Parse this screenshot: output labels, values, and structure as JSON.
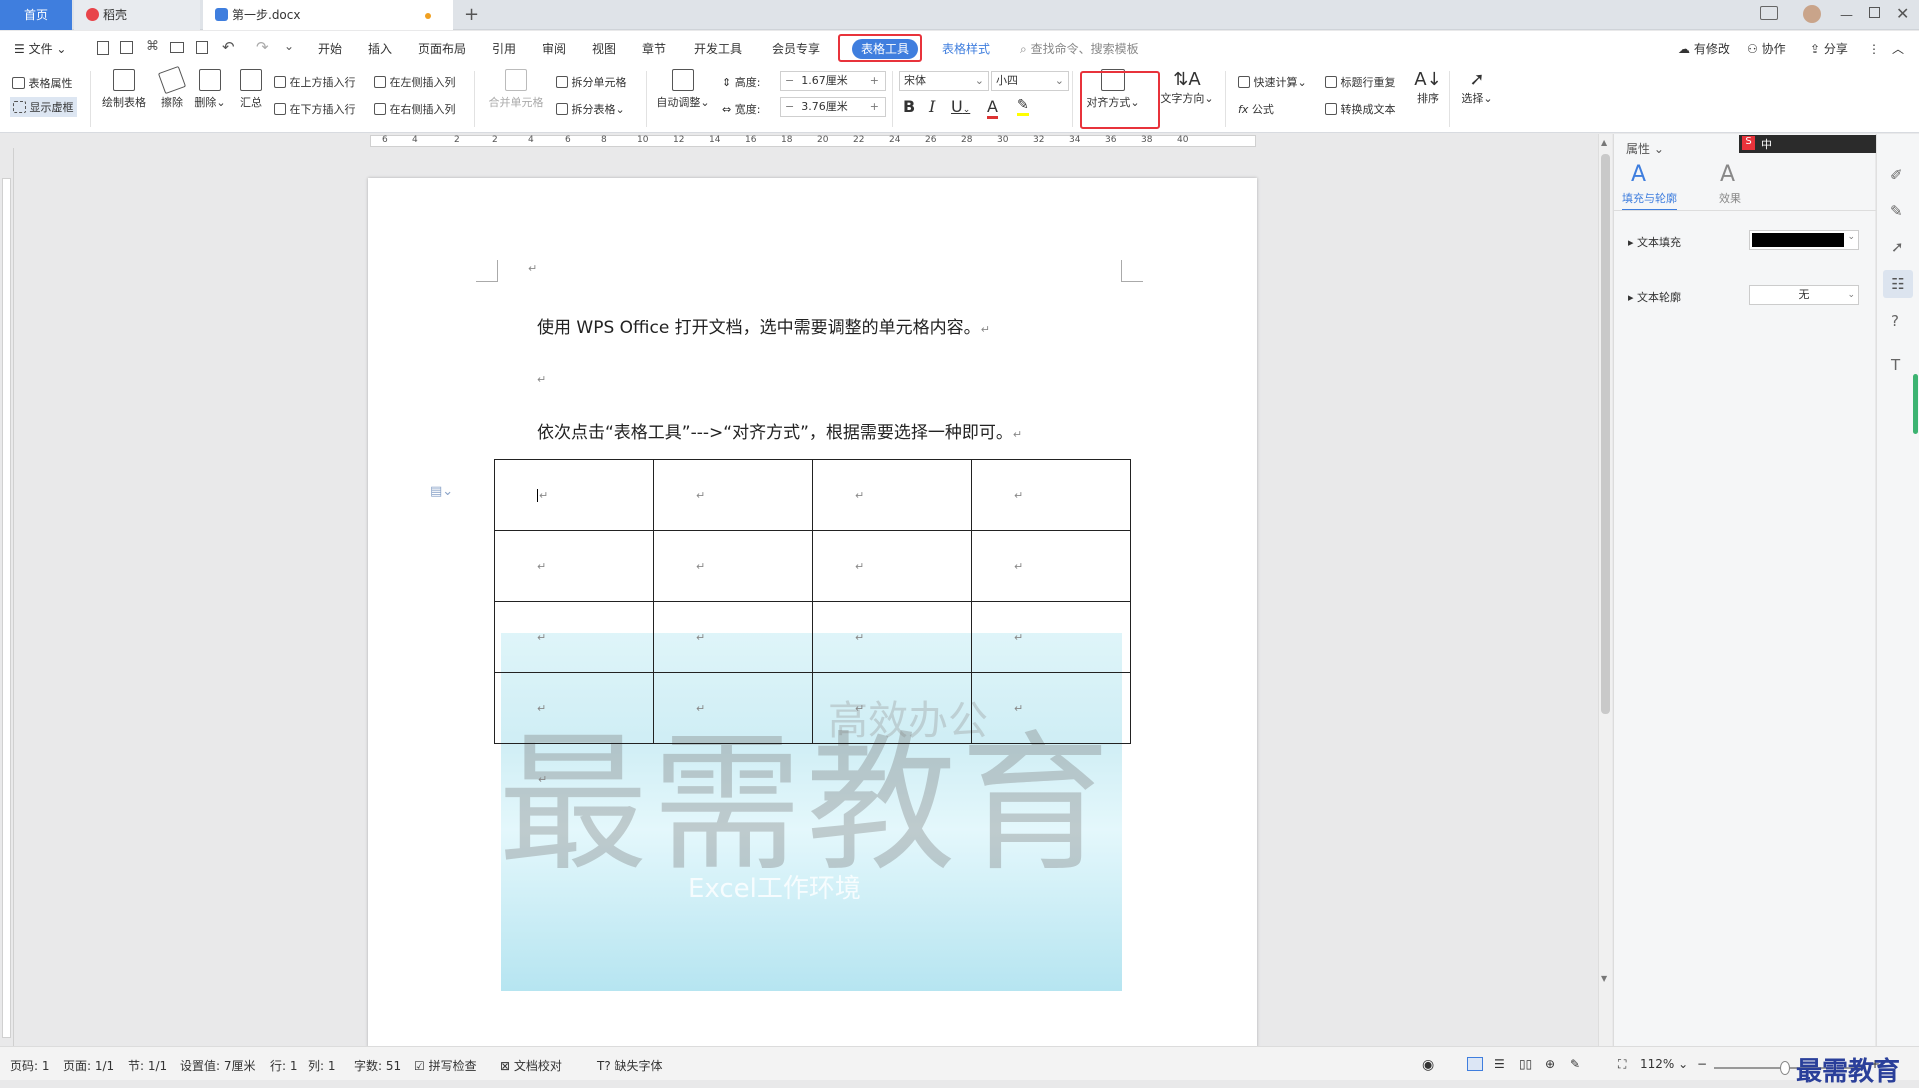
{
  "tabs": [
    {
      "label": "首页"
    },
    {
      "label": "稻壳"
    },
    {
      "label": "第一步.docx"
    }
  ],
  "menu": {
    "file": "文件",
    "items": [
      "开始",
      "插入",
      "页面布局",
      "引用",
      "审阅",
      "视图",
      "章节",
      "开发工具",
      "会员专享",
      "表格工具",
      "表格样式"
    ],
    "search": "查找命令、搜索模板",
    "right": [
      "有修改",
      "协作",
      "分享"
    ]
  },
  "ribbon": {
    "table_props": "表格属性",
    "show_grid": "显示虚框",
    "draw_table": "绘制表格",
    "erase": "擦除",
    "delete": "删除",
    "summary": "汇总",
    "insert_above": "在上方插入行",
    "insert_below": "在下方插入行",
    "insert_left": "在左侧插入列",
    "insert_right": "在右侧插入列",
    "merge_cells": "合并单元格",
    "split_cells": "拆分单元格",
    "split_table": "拆分表格",
    "auto_adjust": "自动调整",
    "height_label": "高度:",
    "height_value": "1.67厘米",
    "width_label": "宽度:",
    "width_value": "3.76厘米",
    "font_name": "宋体",
    "font_size": "小四",
    "align": "对齐方式",
    "text_direction": "文字方向",
    "quick_calc": "快速计算",
    "formula": "公式",
    "repeat_header": "标题行重复",
    "convert_text": "转换成文本",
    "sort": "排序",
    "select": "选择"
  },
  "ruler_numbers": [
    "6",
    "4",
    "2",
    "2",
    "4",
    "6",
    "8",
    "10",
    "12",
    "14",
    "16",
    "18",
    "20",
    "22",
    "24",
    "26",
    "28",
    "30",
    "32",
    "34",
    "36",
    "38",
    "40"
  ],
  "doc": {
    "line1": "使用 WPS Office 打开文档，选中需要调整的单元格内容。",
    "line2": "依次点击“表格工具”--->“对齐方式”，根据需要选择一种即可。",
    "watermark_main": "最需教育",
    "watermark_top": "高效办公",
    "watermark_sub": "Excel工作环境"
  },
  "panel": {
    "title": "属性",
    "tab1": "填充与轮廓",
    "tab2": "效果",
    "fill_label": "文本填充",
    "outline_label": "文本轮廓",
    "outline_value": "无",
    "ime_label": "中"
  },
  "status": {
    "page": "页码: 1",
    "pages": "页面: 1/1",
    "section": "节: 1/1",
    "setting": "设置值: 7厘米",
    "row": "行: 1",
    "col": "列: 1",
    "words": "字数: 51",
    "spell": "拼写检查",
    "proof": "文档校对",
    "missing_font": "缺失字体",
    "zoom": "112%"
  },
  "brand": "最需教育",
  "colors": {
    "accent": "#3f7ede",
    "highlight": "#e8333b"
  }
}
